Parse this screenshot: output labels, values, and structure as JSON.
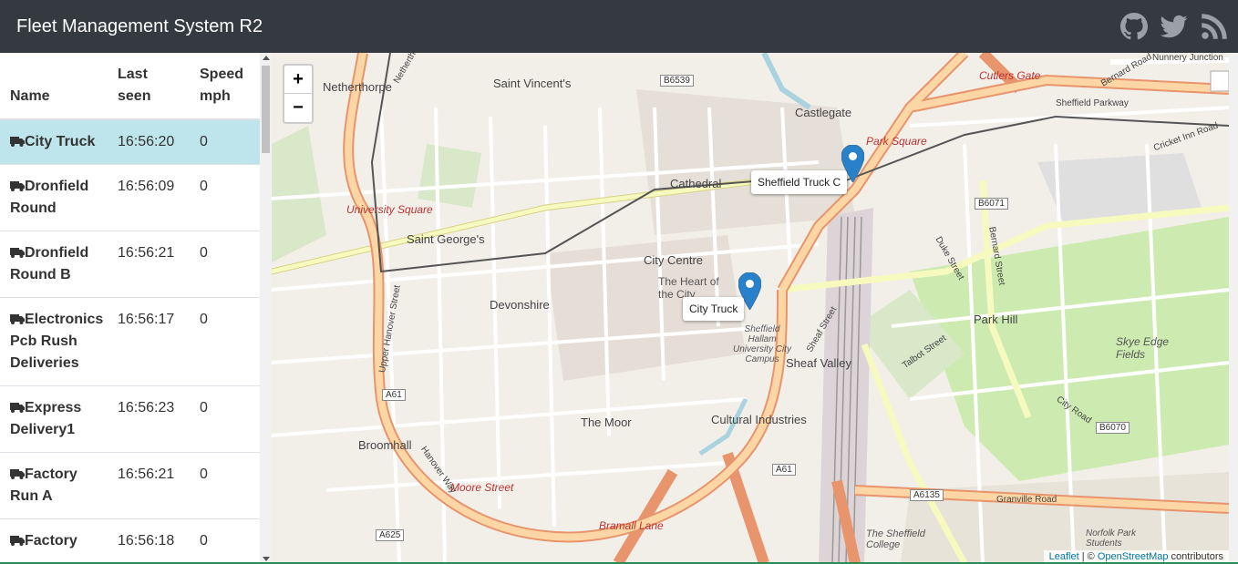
{
  "app": {
    "title": "Fleet Management System R2"
  },
  "nav": {
    "icons": [
      "github-icon",
      "twitter-icon",
      "rss-icon"
    ]
  },
  "table": {
    "headers": {
      "name": "Name",
      "last_seen": "Last seen",
      "speed": "Speed mph"
    },
    "rows": [
      {
        "name": "City Truck",
        "last_seen": "16:56:20",
        "speed": "0",
        "selected": true
      },
      {
        "name": "Dronfield Round",
        "last_seen": "16:56:09",
        "speed": "0"
      },
      {
        "name": "Dronfield Round B",
        "last_seen": "16:56:21",
        "speed": "0"
      },
      {
        "name": "Electronics Pcb Rush Deliveries",
        "last_seen": "16:56:17",
        "speed": "0"
      },
      {
        "name": "Express Delivery1",
        "last_seen": "16:56:23",
        "speed": "0"
      },
      {
        "name": "Factory Run A",
        "last_seen": "16:56:21",
        "speed": "0"
      },
      {
        "name": "Factory",
        "last_seen": "16:56:18",
        "speed": "0"
      }
    ]
  },
  "map": {
    "zoom_in": "+",
    "zoom_out": "−",
    "markers": [
      {
        "label": "Sheffield Truck C"
      },
      {
        "label": "City Truck"
      }
    ],
    "labels": {
      "netherthorpe": "Netherthorpe",
      "st_vincents": "Saint Vincent's",
      "castlegate": "Castlegate",
      "cathedral": "Cathedral",
      "cutlers_gate": "Cutlers Gate",
      "sheffield_parkway": "Sheffield Parkway",
      "park_square": "Park Square",
      "university_square": "University Square",
      "st_georges": "Saint George's",
      "city_centre": "City Centre",
      "heart_of_city": "The Heart of the City",
      "devonshire": "Devonshire",
      "shu": "Sheffield Hallam University City Campus",
      "sheaf_valley": "Sheaf Valley",
      "park_hill": "Park Hill",
      "skye_edge": "Skye Edge Fields",
      "the_moor": "The Moor",
      "cultural_industries": "Cultural Industries",
      "broomhall": "Broomhall",
      "moore_street": "Moore Street",
      "bramall_lane": "Bramall Lane",
      "sheffield_college": "The Sheffield College",
      "netherthorpe_road": "Netherthorpe Road",
      "upper_hanover": "Upper Hanover Street",
      "hanover_way": "Hanover Way",
      "sheaf_street": "Sheaf Street",
      "duke_street": "Duke Street",
      "bernard_street": "Bernard Street",
      "granville_road": "Granville Road",
      "city_road": "City Road",
      "talbot_street": "Talbot Street",
      "cricket_inn_road": "Cricket Inn Road",
      "nunnery_junction": "Nunnery Junction",
      "bernard_road": "Bernard Road",
      "norfolk_park_students": "Norfolk Park Students"
    },
    "shields": {
      "b6539": "B6539",
      "b6071": "B6071",
      "a61_west": "A61",
      "a61_south": "A61",
      "a6135": "A6135",
      "b6070": "B6070",
      "a625": "A625"
    },
    "attribution": {
      "leaflet": "Leaflet",
      "sep": " | © ",
      "osm": "OpenStreetMap",
      "rest": " contributors"
    }
  }
}
